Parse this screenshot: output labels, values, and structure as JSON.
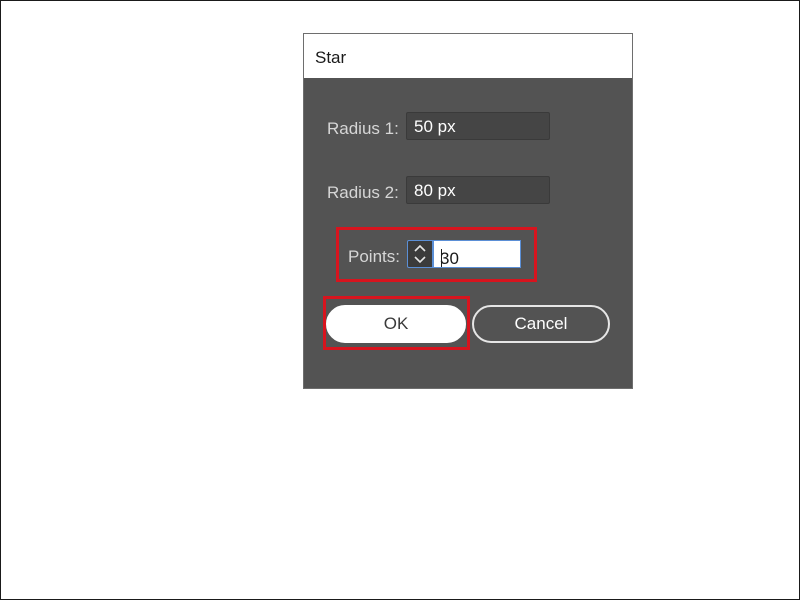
{
  "dialog": {
    "title": "Star",
    "radius1": {
      "label": "Radius 1:",
      "value": "50 px"
    },
    "radius2": {
      "label": "Radius 2:",
      "value": "80 px"
    },
    "points": {
      "label": "Points:",
      "value": "30"
    },
    "ok_label": "OK",
    "cancel_label": "Cancel"
  },
  "colors": {
    "dialog_background": "#535353",
    "highlight": "#d7141e",
    "focus_border": "#5b8fd6"
  },
  "icons": {
    "stepper": "up-down-chevron-icon"
  }
}
